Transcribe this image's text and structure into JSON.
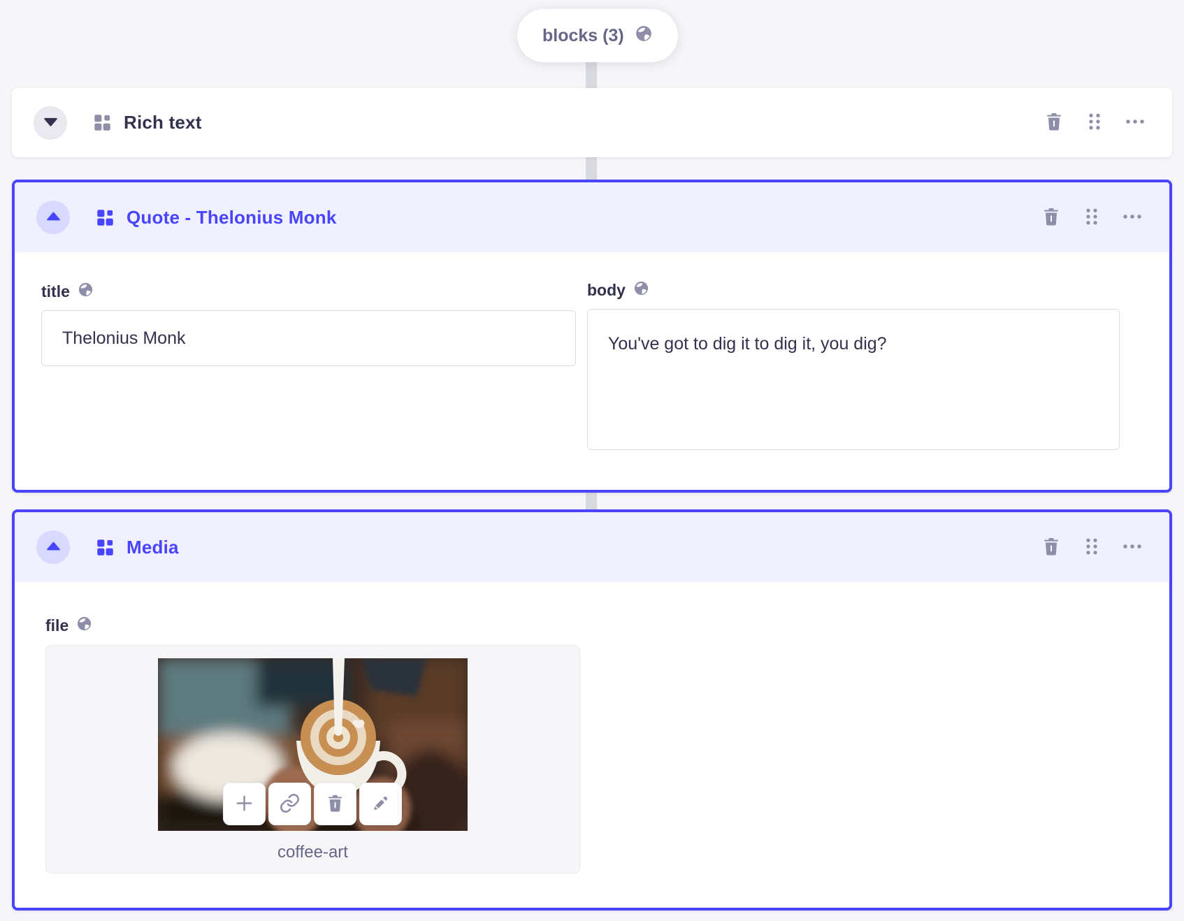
{
  "pill": {
    "label": "blocks (3)",
    "icon": "globe-icon"
  },
  "blocks": {
    "rich_text": {
      "title": "Rich text",
      "state": "collapsed"
    },
    "quote": {
      "title": "Quote - Thelonius Monk",
      "state": "expanded",
      "fields": {
        "title": {
          "label": "title",
          "value": "Thelonius Monk",
          "localized_icon": "globe-icon"
        },
        "body": {
          "label": "body",
          "value": "You've got to dig it to dig it, you dig?",
          "localized_icon": "globe-icon"
        }
      }
    },
    "media": {
      "title": "Media",
      "state": "expanded",
      "fields": {
        "file": {
          "label": "file",
          "filename": "coffee-art",
          "localized_icon": "globe-icon"
        }
      }
    }
  },
  "header_actions": {
    "delete_icon": "trash-icon",
    "drag_icon": "drag-handle-icon",
    "more_icon": "more-options-icon"
  },
  "media_actions": {
    "add_icon": "plus-icon",
    "link_icon": "link-icon",
    "delete_icon": "trash-icon",
    "edit_icon": "pencil-icon"
  },
  "colors": {
    "primary": "#4945ff",
    "primary_header_bg": "#f0f0ff",
    "primary_toggle_bg": "#d9d8ff",
    "icon_gray": "#8e8ea9",
    "text_dark": "#32324d",
    "text_gray": "#666687",
    "page_bg": "#f6f6f9",
    "connector": "#d9d9e0",
    "input_border": "#dcdce4"
  }
}
